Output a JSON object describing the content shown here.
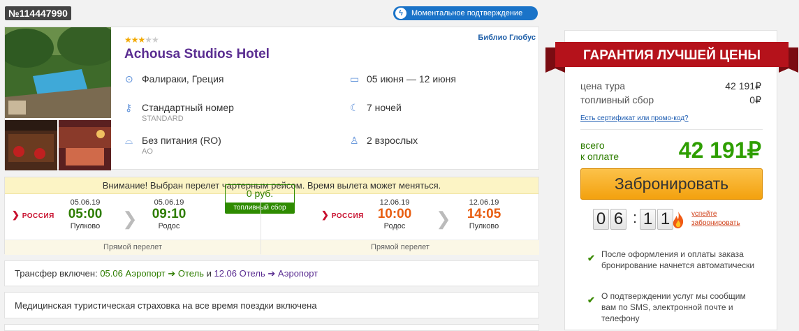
{
  "order": {
    "number": "№114447990"
  },
  "badge": {
    "instant": "Моментальное подтверждение"
  },
  "hotel": {
    "stars": 3,
    "max_stars": 5,
    "name": "Achousa Studios Hotel",
    "operator": "Библио Глобус",
    "location": "Фалираки, Греция",
    "dates": "05 июня — 12 июня",
    "room": "Стандартный номер",
    "room_code": "STANDARD",
    "nights": "7 ночей",
    "meal": "Без питания (RO)",
    "meal_code": "AO",
    "guests": "2 взрослых"
  },
  "flight": {
    "warning": "Внимание! Выбран перелет чартерным рейсом. Время вылета может меняться.",
    "outbound": {
      "airline": "РОССИЯ",
      "dep_date": "05.06.19",
      "dep_time": "05:00",
      "dep_city": "Пулково",
      "arr_date": "05.06.19",
      "arr_time": "09:10",
      "arr_city": "Родос",
      "type": "Прямой перелет"
    },
    "fee_value": "0 руб.",
    "fee_label": "топливный сбор",
    "inbound": {
      "airline": "РОССИЯ",
      "dep_date": "12.06.19",
      "dep_time": "10:00",
      "dep_city": "Родос",
      "arr_date": "12.06.19",
      "arr_time": "14:05",
      "arr_city": "Пулково",
      "type": "Прямой перелет"
    }
  },
  "transfer": {
    "label": "Трансфер включен:",
    "d1": "05.06",
    "r1a": "Аэропорт",
    "arrow": "➔",
    "r1b": "Отель",
    "and": "и",
    "d2": "12.06",
    "r2a": "Отель",
    "r2b": "Аэропорт"
  },
  "insurance": "Медицинская туристическая страховка на все время поездки включена",
  "price": {
    "banner": "ГАРАНТИЯ ЛУЧШЕЙ ЦЕНЫ",
    "tour_label": "цена тура",
    "tour_value": "42 191₽",
    "fuel_label": "топливный сбор",
    "fuel_value": "0₽",
    "promo": "Есть сертификат или промо-код?",
    "total_label_1": "всего",
    "total_label_2": "к оплате",
    "total": "42 191₽",
    "book": "Забронировать",
    "timer": [
      "0",
      "6",
      "1",
      "1"
    ],
    "hurry_1": "успейте",
    "hurry_2": "забронировать"
  },
  "notes": [
    "После оформления и оплаты заказа бронирование начнется автоматически",
    "О подтверждении услуг мы сообщим вам по SMS, электронной почте и телефону"
  ],
  "colors": {
    "purple": "#5a2d91",
    "green": "#2e7d00",
    "orange": "#e85d10",
    "banner_red": "#b5121b",
    "button": "#f3a10e"
  }
}
